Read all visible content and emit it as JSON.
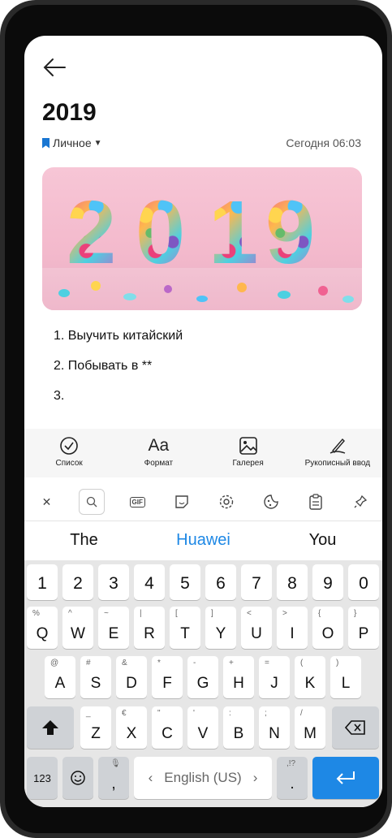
{
  "note": {
    "title": "2019",
    "category": "Личное",
    "date": "Сегодня 06:03",
    "image_text": "2019",
    "list": [
      "1. Выучить китайский",
      "2. Побывать в **",
      "3."
    ]
  },
  "toolbar": {
    "items": [
      {
        "label": "Список",
        "icon": "checklist-icon"
      },
      {
        "label": "Формат",
        "icon": "format-icon",
        "glyph": "Aa"
      },
      {
        "label": "Галерея",
        "icon": "gallery-icon"
      },
      {
        "label": "Рукописный ввод",
        "icon": "handwriting-icon"
      }
    ]
  },
  "keyboard": {
    "top_bar_icons": [
      "close-icon",
      "search-icon",
      "gif-icon",
      "sticker-icon",
      "settings-icon",
      "theme-icon",
      "clipboard-icon",
      "pin-icon"
    ],
    "suggestions": [
      "The",
      "Huawei",
      "You"
    ],
    "numbers": [
      "1",
      "2",
      "3",
      "4",
      "5",
      "6",
      "7",
      "8",
      "9",
      "0"
    ],
    "row1": [
      [
        "Q",
        "%"
      ],
      [
        "W",
        "^"
      ],
      [
        "E",
        "~"
      ],
      [
        "R",
        "|"
      ],
      [
        "T",
        "["
      ],
      [
        "Y",
        "]"
      ],
      [
        "U",
        "<"
      ],
      [
        "I",
        ">"
      ],
      [
        "O",
        "{"
      ],
      [
        "P",
        "}"
      ]
    ],
    "row2": [
      [
        "A",
        "@"
      ],
      [
        "S",
        "#"
      ],
      [
        "D",
        "&"
      ],
      [
        "F",
        "*"
      ],
      [
        "G",
        "-"
      ],
      [
        "H",
        "+"
      ],
      [
        "J",
        "="
      ],
      [
        "K",
        "("
      ],
      [
        "L",
        ")"
      ]
    ],
    "row3": [
      [
        "Z",
        "_"
      ],
      [
        "X",
        "€"
      ],
      [
        "C",
        "\""
      ],
      [
        "V",
        "'"
      ],
      [
        "B",
        ":"
      ],
      [
        "N",
        ";"
      ],
      [
        "M",
        "/"
      ]
    ],
    "num_key": "123",
    "comma": ",",
    "space_label": "English (US)",
    "space_left": "‹",
    "space_right": "›",
    "period": ".",
    "period_sub": ",!?",
    "accent": "#1e88e5"
  }
}
